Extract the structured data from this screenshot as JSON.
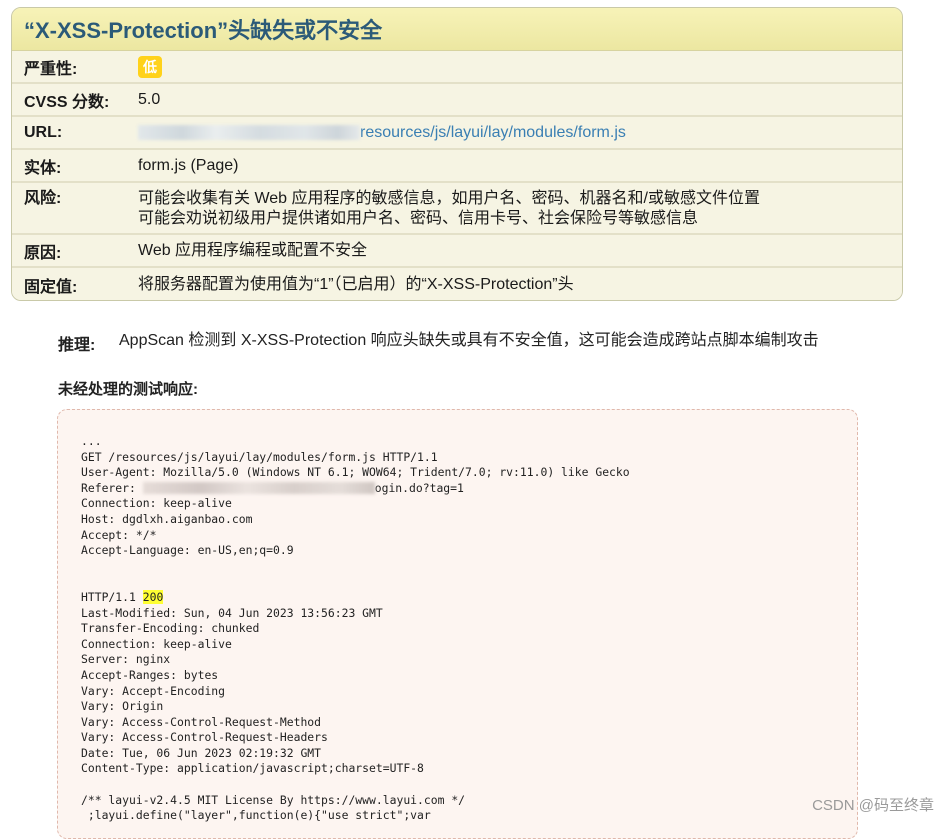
{
  "issue": {
    "title": "“X-XSS-Protection”头缺失或不安全",
    "rows": {
      "severity": {
        "label": "严重性:",
        "value": "低"
      },
      "cvss": {
        "label": "CVSS 分数:",
        "value": "5.0"
      },
      "url": {
        "label": "URL:",
        "value": "resources/js/layui/lay/modules/form.js"
      },
      "entity": {
        "label": "实体:",
        "value": "form.js (Page)"
      },
      "risk": {
        "label": "风险:",
        "line1": "可能会收集有关 Web 应用程序的敏感信息，如用户名、密码、机器名和/或敏感文件位置",
        "line2": "可能会劝说初级用户提供诸如用户名、密码、信用卡号、社会保险号等敏感信息"
      },
      "cause": {
        "label": "原因:",
        "value": "Web 应用程序编程或配置不安全"
      },
      "fix": {
        "label": "固定值:",
        "value": "将服务器配置为使用值为“1”（已启用）的“X-XSS-Protection”头"
      }
    },
    "badge_color": "#ffd21a",
    "title_color": "#2b5a78"
  },
  "reasoning": {
    "label": "推理:",
    "value": "AppScan 检测到 X-XSS-Protection 响应头缺失或具有不安全值，这可能会造成跨站点脚本编制攻击"
  },
  "raw_response": {
    "title": "未经处理的测试响应:",
    "request_lines": [
      "...",
      "GET /resources/js/layui/lay/modules/form.js HTTP/1.1",
      "User-Agent: Mozilla/5.0 (Windows NT 6.1; WOW64; Trident/7.0; rv:11.0) like Gecko"
    ],
    "referer_prefix": "Referer: ",
    "referer_suffix": "ogin.do?tag=1",
    "request_lines2": [
      "Connection: keep-alive",
      "Host: dgdlxh.aiganbao.com",
      "Accept: */*",
      "Accept-Language: en-US,en;q=0.9"
    ],
    "status_prefix": "HTTP/1.1 ",
    "status_code": "200",
    "response_lines": [
      "Last-Modified: Sun, 04 Jun 2023 13:56:23 GMT",
      "Transfer-Encoding: chunked",
      "Connection: keep-alive",
      "Server: nginx",
      "Accept-Ranges: bytes",
      "Vary: Accept-Encoding",
      "Vary: Origin",
      "Vary: Access-Control-Request-Method",
      "Vary: Access-Control-Request-Headers",
      "Date: Tue, 06 Jun 2023 02:19:32 GMT",
      "Content-Type: application/javascript;charset=UTF-8"
    ],
    "body_lines": [
      "/** layui-v2.4.5 MIT License By https://www.layui.com */",
      " ;layui.define(\"layer\",function(e){\"use strict\";var"
    ]
  },
  "watermark": "CSDN @码至终章"
}
